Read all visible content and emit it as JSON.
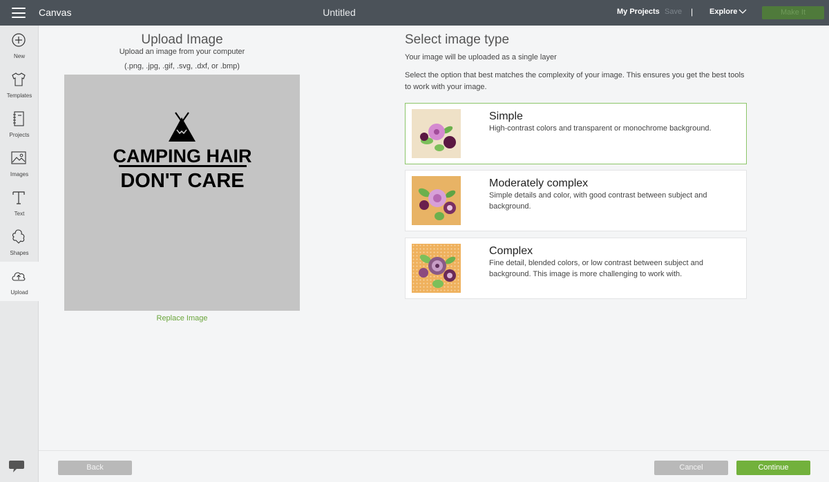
{
  "topbar": {
    "app_name": "Canvas",
    "doc_title": "Untitled",
    "my_projects": "My Projects",
    "save": "Save",
    "separator": "|",
    "explore": "Explore",
    "make_it": "Make It"
  },
  "sidebar": {
    "items": [
      {
        "label": "New",
        "icon": "plus-circle-icon"
      },
      {
        "label": "Templates",
        "icon": "tshirt-icon"
      },
      {
        "label": "Projects",
        "icon": "notebook-icon"
      },
      {
        "label": "Images",
        "icon": "image-icon"
      },
      {
        "label": "Text",
        "icon": "text-icon"
      },
      {
        "label": "Shapes",
        "icon": "shapes-icon"
      },
      {
        "label": "Upload",
        "icon": "cloud-upload-icon"
      }
    ],
    "active": "Upload"
  },
  "upload": {
    "title": "Upload Image",
    "subtitle": "Upload an image from your computer",
    "formats": "(.png, .jpg, .gif, .svg, .dxf, or .bmp)",
    "preview_line1": "CAMPING HAIR",
    "preview_line2": "DON'T CARE",
    "replace": "Replace Image"
  },
  "image_type": {
    "title": "Select image type",
    "note": "Your image will be uploaded as a single layer",
    "description": "Select the option that best matches the complexity of your image. This ensures you get the best tools to work with your image.",
    "options": [
      {
        "title": "Simple",
        "desc": "High-contrast colors and transparent or monochrome background.",
        "selected": true,
        "thumb_bg": "#efe1c7"
      },
      {
        "title": "Moderately complex",
        "desc": "Simple details and color, with good contrast between subject and background.",
        "selected": false,
        "thumb_bg": "#e8b365"
      },
      {
        "title": "Complex",
        "desc": "Fine detail, blended colors, or low contrast between subject and background. This image is more challenging to work with.",
        "selected": false,
        "thumb_bg": "#efb15d"
      }
    ]
  },
  "footer": {
    "back": "Back",
    "cancel": "Cancel",
    "continue": "Continue"
  },
  "colors": {
    "topbar": "#4b5259",
    "accent_green": "#72b13c",
    "selected_border": "#8cc569"
  }
}
